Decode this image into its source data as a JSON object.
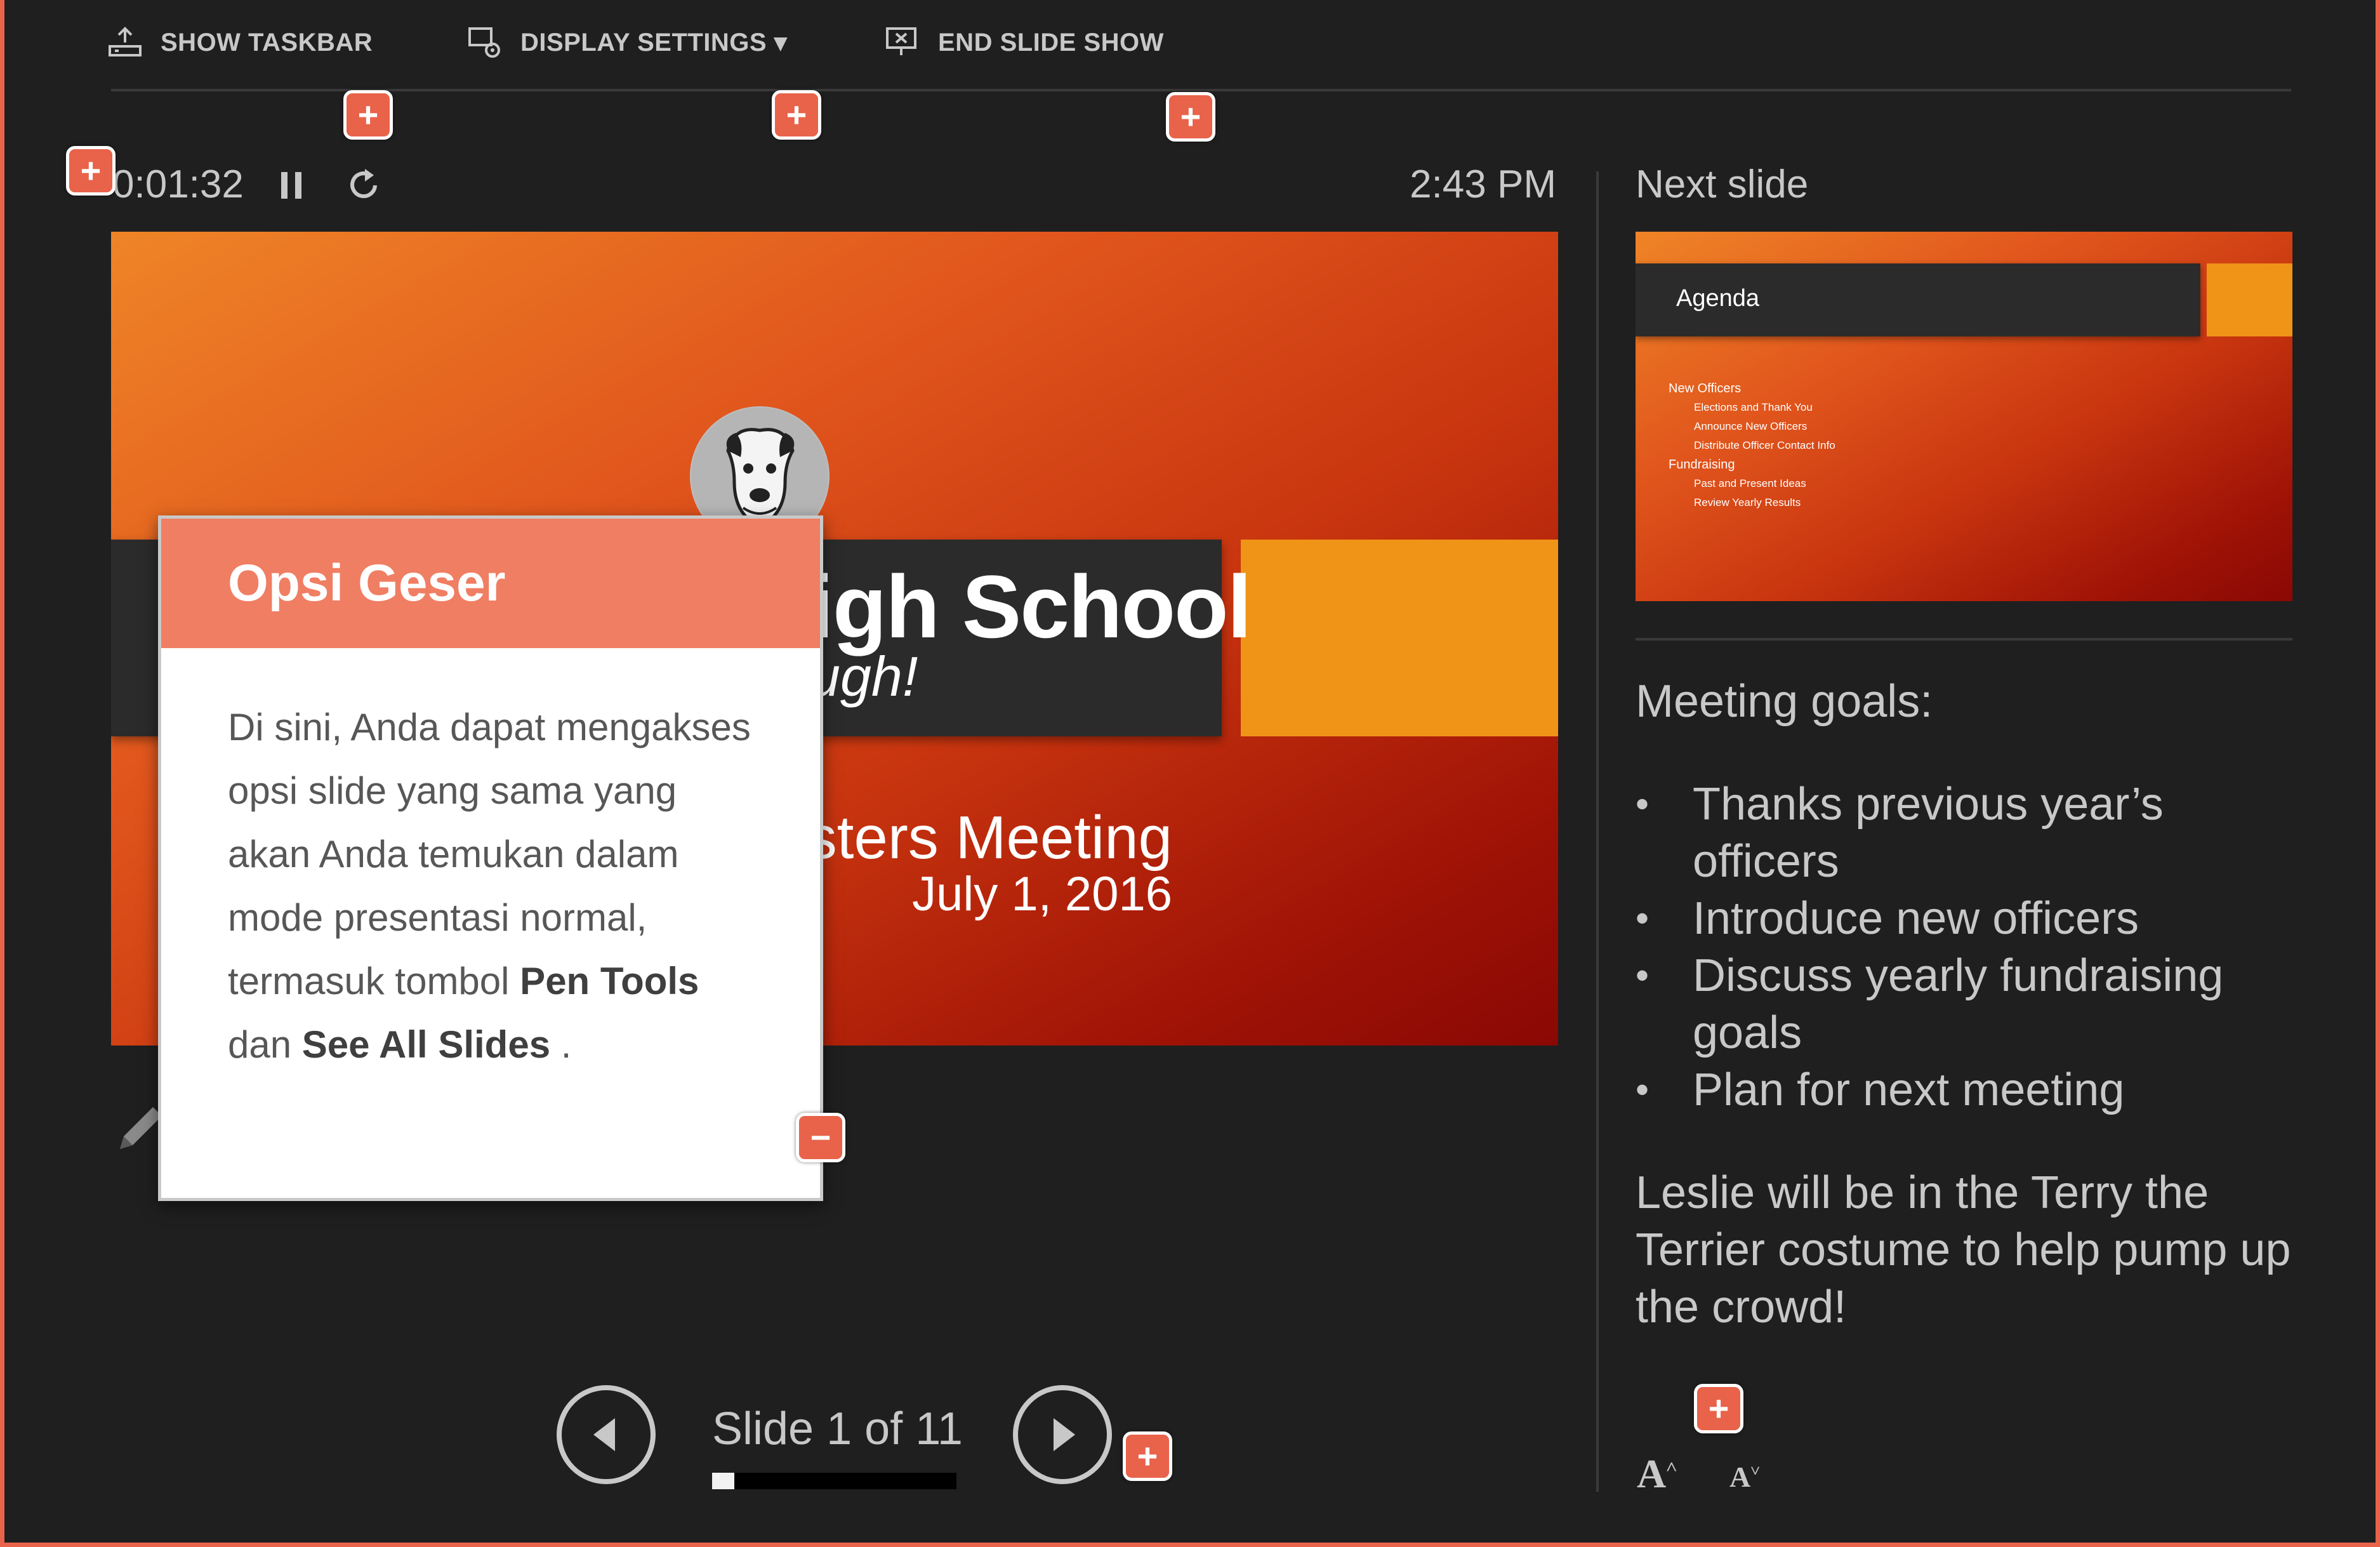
{
  "toolbar": {
    "show_taskbar": "SHOW TASKBAR",
    "display_settings": "DISPLAY SETTINGS ▾",
    "end_slide_show": "END SLIDE SHOW"
  },
  "timer": {
    "elapsed": "0:01:32",
    "clock": "2:43 PM"
  },
  "current_slide": {
    "title_visible": "igh School",
    "tagline_visible": "ugh!",
    "subtitle_visible": "sters Meeting",
    "date": "July 1, 2016"
  },
  "callout": {
    "title": "Opsi Geser",
    "body_prefix": "Di sini, Anda dapat mengakses opsi slide yang sama yang akan Anda temukan dalam mode presentasi normal, termasuk tombol ",
    "pen_tools": "Pen Tools",
    "connector": " dan ",
    "see_all_slides": "See All Slides",
    "body_suffix": " .",
    "collapse_glyph": "−"
  },
  "navigation": {
    "slide_counter": "Slide 1 of 11",
    "progress": 0.09
  },
  "next_slide": {
    "label": "Next slide",
    "title": "Agenda",
    "bullets": [
      "New Officers",
      "Elections and Thank You",
      "Announce New Officers",
      "Distribute Officer Contact Info",
      "Fundraising",
      "Past and Present Ideas",
      "Review Yearly Results"
    ]
  },
  "notes": {
    "heading": "Meeting goals:",
    "items": [
      "Thanks previous year’s officers",
      "Introduce new officers",
      "Discuss yearly fundraising goals",
      "Plan for next meeting"
    ],
    "closing": "Leslie will be in the Terry the Terrier costume to help pump up the crowd!"
  },
  "font_controls": {
    "increase": "A",
    "decrease": "A"
  },
  "hotspot": {
    "glyph": "+"
  },
  "colors": {
    "background": "#1f1f1f",
    "accent": "#e8634a",
    "callout_header": "#f07e63",
    "slide_orange": "#ef9416"
  }
}
